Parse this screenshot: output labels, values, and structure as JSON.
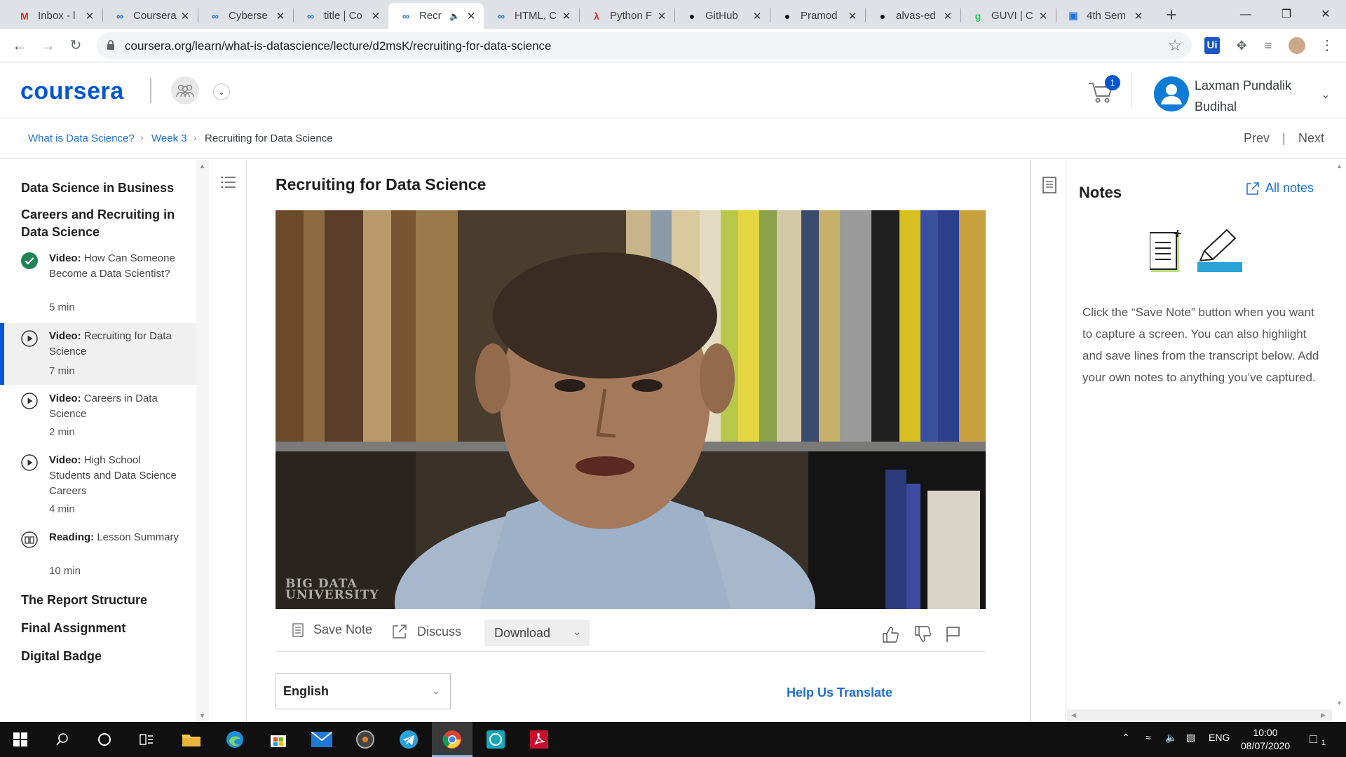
{
  "browser": {
    "tabs": [
      {
        "title": "Inbox - l",
        "icon": "gmail-icon",
        "color": "#d93025"
      },
      {
        "title": "Coursera",
        "icon": "coursera-infinity-icon",
        "color": "#1a73e8"
      },
      {
        "title": "Cyberse",
        "icon": "coursera-infinity-icon",
        "color": "#1a73e8"
      },
      {
        "title": "title | Co",
        "icon": "coursera-infinity-icon",
        "color": "#1a73e8"
      },
      {
        "title": "Recr",
        "icon": "coursera-infinity-icon",
        "color": "#1a73e8",
        "active": true
      },
      {
        "title": "HTML, C",
        "icon": "coursera-infinity-icon",
        "color": "#1a73e8"
      },
      {
        "title": "Python F",
        "icon": "python-tutor-icon",
        "color": "#d93025"
      },
      {
        "title": "GitHub",
        "icon": "github-icon",
        "color": "#111111"
      },
      {
        "title": "Pramod",
        "icon": "github-icon",
        "color": "#111111"
      },
      {
        "title": "alvas-ed",
        "icon": "github-icon",
        "color": "#111111"
      },
      {
        "title": "GUVI | C",
        "icon": "guvi-icon",
        "color": "#22c55e"
      },
      {
        "title": "4th Sem",
        "icon": "classroom-icon",
        "color": "#1a73e8"
      }
    ],
    "url": "coursera.org/learn/what-is-datascience/lecture/d2msK/recruiting-for-data-science"
  },
  "header": {
    "logo": "coursera",
    "cart_count": "1",
    "user_name_line1": "Laxman Pundalik",
    "user_name_line2": "Budihal"
  },
  "breadcrumb": {
    "course": "What is Data Science?",
    "week": "Week 3",
    "current": "Recruiting for Data Science",
    "prev": "Prev",
    "next": "Next"
  },
  "sidebar": {
    "modules_top": [
      {
        "title": "Data Science in Business"
      },
      {
        "title": "Careers and Recruiting in Data Science"
      }
    ],
    "lessons": [
      {
        "type": "Video:",
        "title": "How Can Someone Become a Data Scientist?",
        "duration": "5 min",
        "status": "completed"
      },
      {
        "type": "Video:",
        "title": "Recruiting for Data Science",
        "duration": "7 min",
        "status": "current"
      },
      {
        "type": "Video:",
        "title": "Careers in Data Science",
        "duration": "2 min",
        "status": "video"
      },
      {
        "type": "Video:",
        "title": "High School Students and Data Science Careers",
        "duration": "4 min",
        "status": "video"
      },
      {
        "type": "Reading:",
        "title": "Lesson Summary",
        "duration": "10 min",
        "status": "reading"
      }
    ],
    "modules_bottom": [
      {
        "title": "The Report Structure"
      },
      {
        "title": "Final Assignment"
      },
      {
        "title": "Digital Badge"
      }
    ]
  },
  "lecture": {
    "title": "Recruiting for Data Science",
    "video_watermark_line1": "BIG DATA",
    "video_watermark_line2": "UNIVERSITY",
    "save_note": "Save Note",
    "discuss": "Discuss",
    "download": "Download",
    "language": "English",
    "help_translate": "Help Us Translate"
  },
  "notes": {
    "title": "Notes",
    "all_notes": "All notes",
    "help_text": "Click the “Save Note” button when you want to capture a screen. You can also highlight and save lines from the transcript below. Add your own notes to anything you’ve captured."
  },
  "taskbar": {
    "lang": "ENG",
    "time": "10:00",
    "date": "08/07/2020",
    "notification_count": "1"
  },
  "colors": {
    "accent": "#0056d2",
    "link": "#1f6fd1",
    "completed": "#1f8354"
  }
}
